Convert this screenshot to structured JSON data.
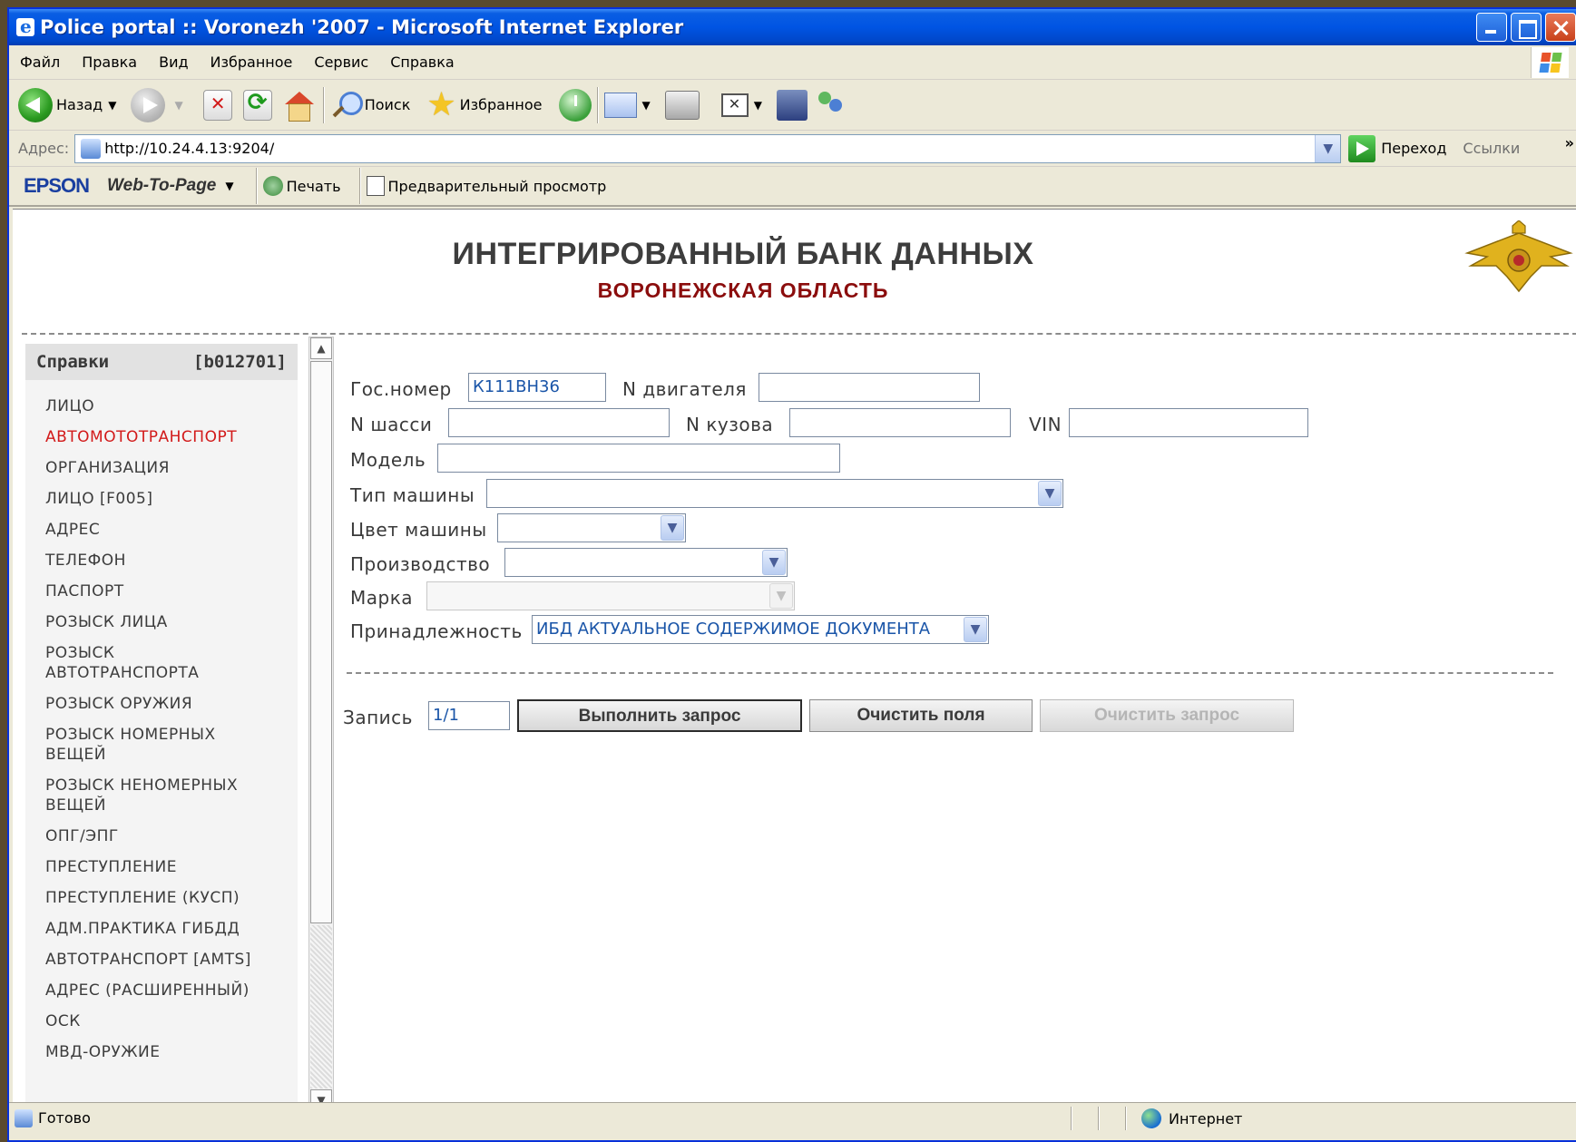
{
  "window": {
    "title": "Police portal :: Voronezh '2007 - Microsoft Internet Explorer"
  },
  "menu": [
    "Файл",
    "Правка",
    "Вид",
    "Избранное",
    "Сервис",
    "Справка"
  ],
  "toolbar": {
    "back_label": "Назад",
    "search_label": "Поиск",
    "favorites_label": "Избранное"
  },
  "address": {
    "label": "Адрес:",
    "url": "http://10.24.4.13:9204/",
    "go_label": "Переход",
    "links_label": "Ссылки",
    "more": "»"
  },
  "epson": {
    "logo": "EPSON",
    "webtopage": "Web-To-Page",
    "print_label": "Печать",
    "preview_label": "Предварительный просмотр"
  },
  "page": {
    "title": "ИНТЕГРИРОВАННЫЙ БАНК ДАННЫХ",
    "subtitle": "ВОРОНЕЖСКАЯ ОБЛАСТЬ"
  },
  "sidebar": {
    "title": "Справки",
    "code": "[b012701]",
    "items": [
      "ЛИЦО",
      "АВТОМОТОТРАНСПОРТ",
      "ОРГАНИЗАЦИЯ",
      "ЛИЦО [F005]",
      "АДРЕС",
      "ТЕЛЕФОН",
      "ПАСПОРТ",
      "РОЗЫСК ЛИЦА",
      "РОЗЫСК АВТОТРАНСПОРТА",
      "РОЗЫСК ОРУЖИЯ",
      "РОЗЫСК НОМЕРНЫХ ВЕЩЕЙ",
      "РОЗЫСК НЕНОМЕРНЫХ ВЕЩЕЙ",
      "ОПГ/ЭПГ",
      "ПРЕСТУПЛЕНИЕ",
      "ПРЕСТУПЛЕНИЕ (КУСП)",
      "АДМ.ПРАКТИКА ГИБДД",
      "АВТОТРАНСПОРТ [AMTS]",
      "АДРЕС (РАСШИРЕННЫЙ)",
      "ОСК",
      "МВД-ОРУЖИЕ"
    ],
    "active_index": 1
  },
  "form": {
    "gos_nomer_label": "Гос.номер",
    "gos_nomer_value": "К111ВН36",
    "engine_label": "N двигателя",
    "engine_value": "",
    "chassis_label": "N шасси",
    "chassis_value": "",
    "body_label": "N кузова",
    "body_value": "",
    "vin_label": "VIN",
    "vin_value": "",
    "model_label": "Модель",
    "model_value": "",
    "type_label": "Тип машины",
    "type_value": "",
    "color_label": "Цвет машины",
    "color_value": "",
    "production_label": "Производство",
    "production_value": "",
    "brand_label": "Марка",
    "brand_value": "",
    "ownership_label": "Принадлежность",
    "ownership_value": "ИБД  АКТУАЛЬНОЕ СОДЕРЖИМОЕ ДОКУМЕНТА",
    "record_label": "Запись",
    "record_value": "1/1",
    "execute_label": "Выполнить запрос",
    "clear_fields_label": "Очистить поля",
    "clear_query_label": "Очистить запрос"
  },
  "status": {
    "text": "Готово",
    "zone": "Интернет"
  },
  "colors": {
    "titlebar": "#0054e3",
    "active_item": "#d21a1a",
    "subtitle": "#8b0d0d"
  }
}
